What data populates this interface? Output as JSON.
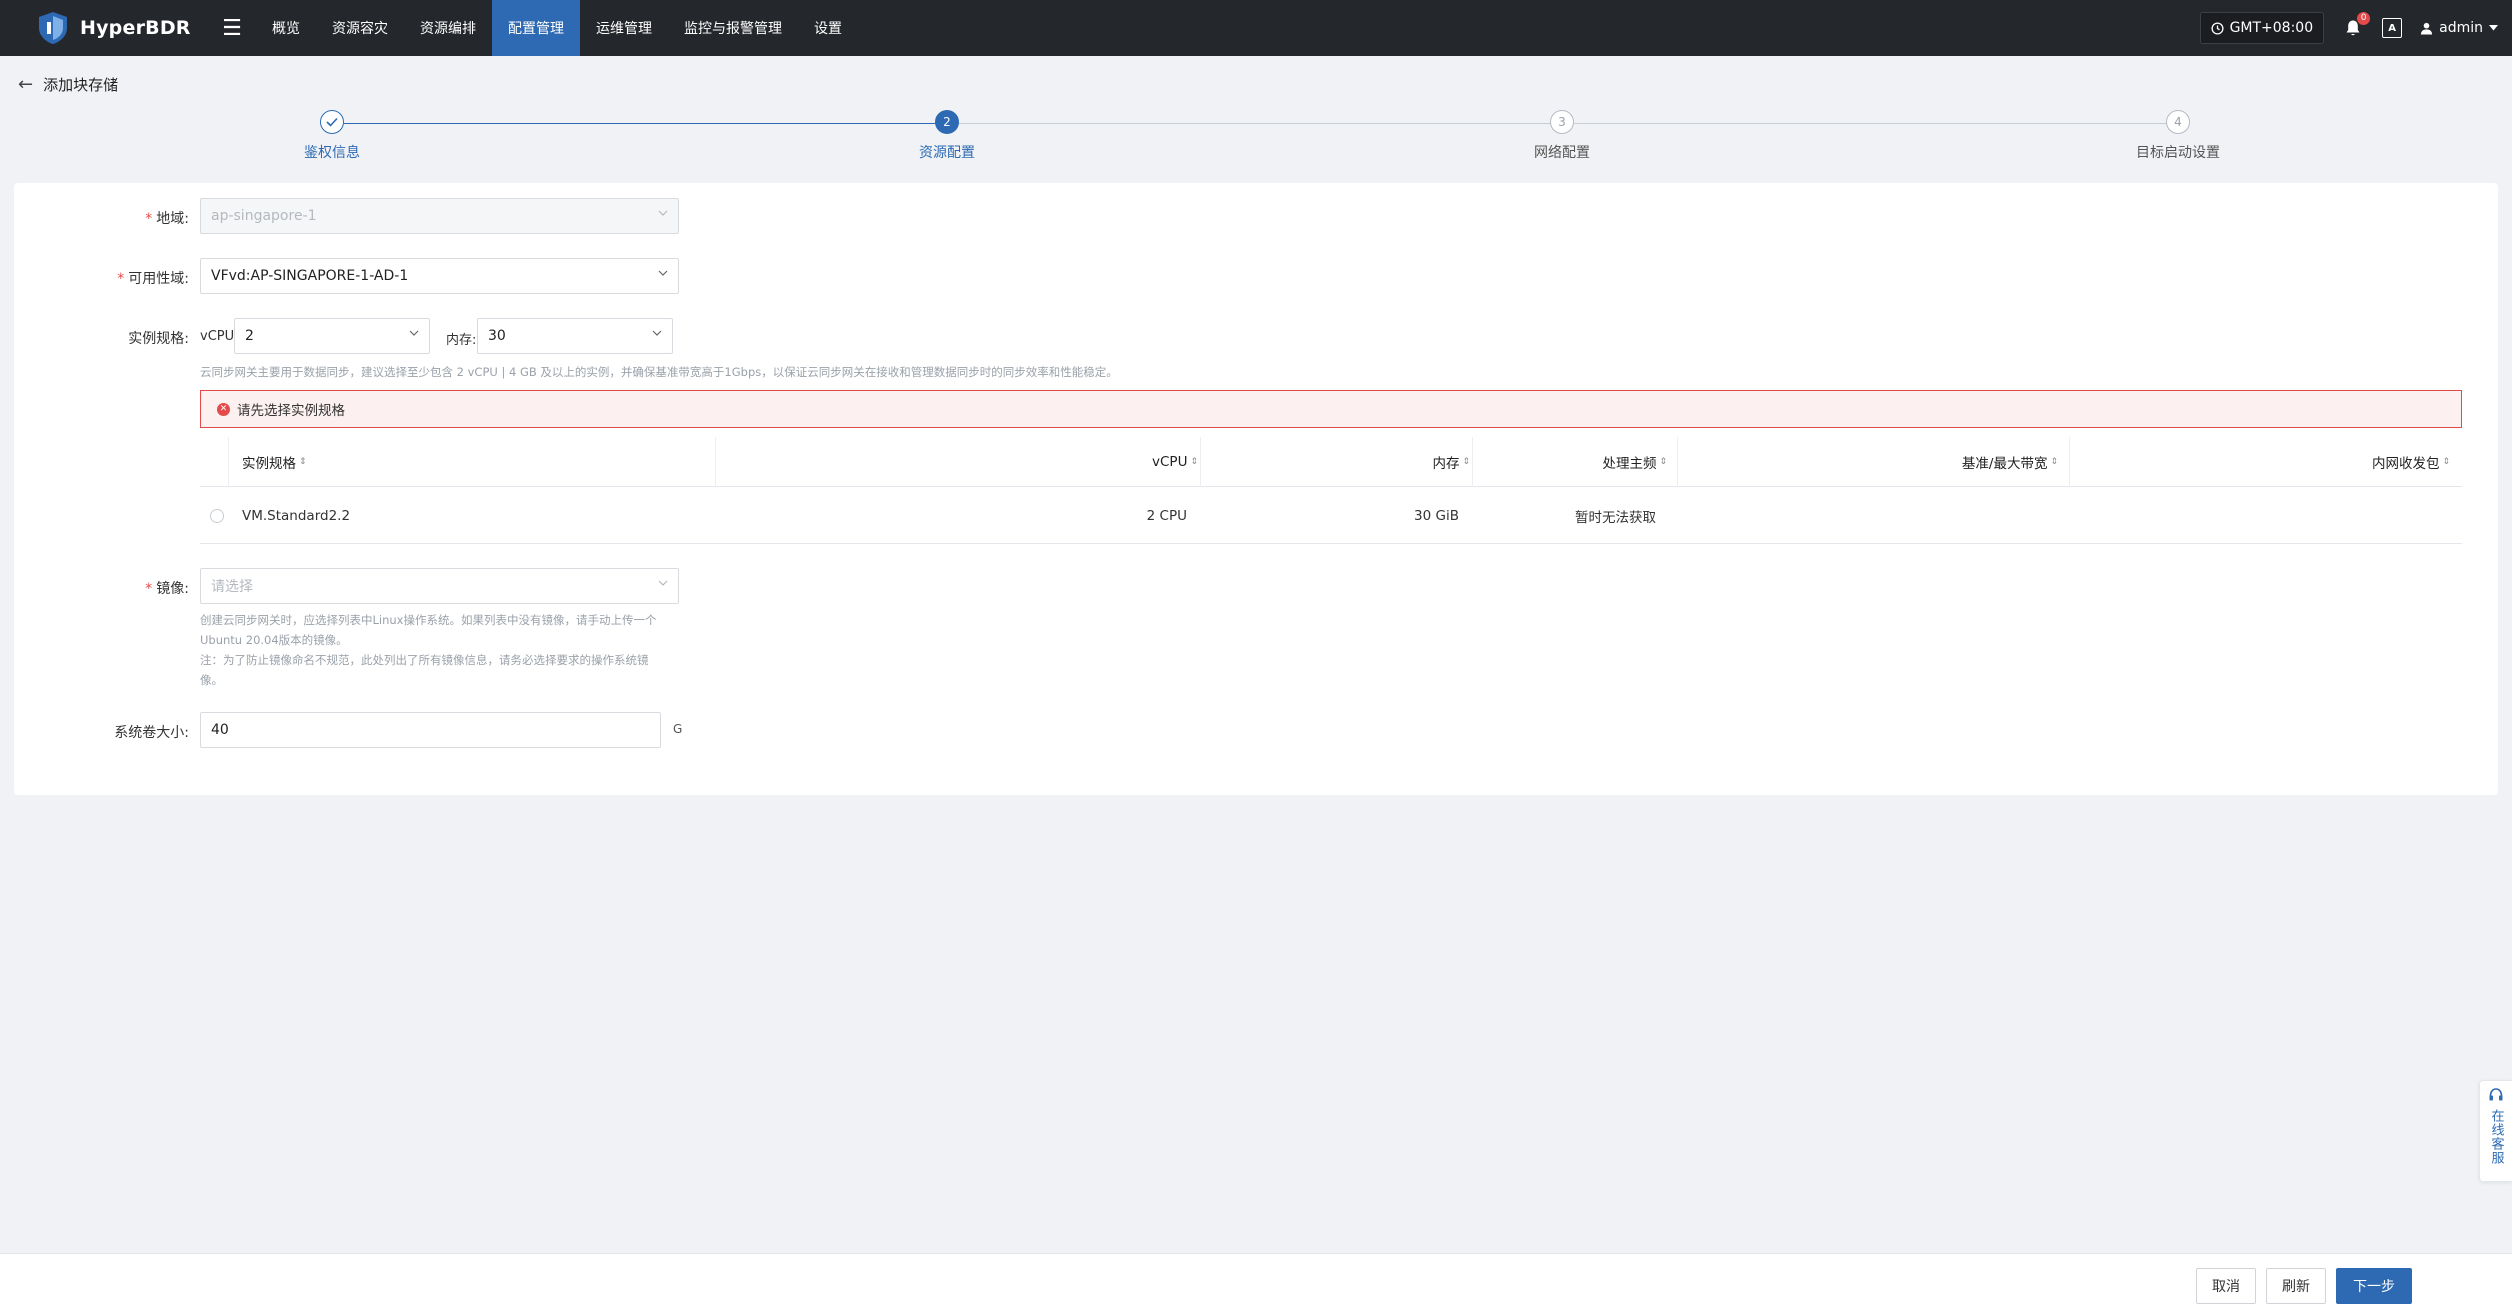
{
  "app": {
    "name": "HyperBDR"
  },
  "nav": {
    "items": [
      {
        "label": "概览",
        "active": false
      },
      {
        "label": "资源容灾",
        "active": false
      },
      {
        "label": "资源编排",
        "active": false
      },
      {
        "label": "配置管理",
        "active": true
      },
      {
        "label": "运维管理",
        "active": false
      },
      {
        "label": "监控与报警管理",
        "active": false
      },
      {
        "label": "设置",
        "active": false
      }
    ]
  },
  "topright": {
    "timezone": "GMT+08:00",
    "bell_badge": "0",
    "lang_icon": "A",
    "user": "admin"
  },
  "page": {
    "title": "添加块存储"
  },
  "steps": [
    {
      "index": "1",
      "label": "鉴权信息",
      "state": "done"
    },
    {
      "index": "2",
      "label": "资源配置",
      "state": "active"
    },
    {
      "index": "3",
      "label": "网络配置",
      "state": "pending"
    },
    {
      "index": "4",
      "label": "目标启动设置",
      "state": "pending"
    }
  ],
  "form": {
    "region": {
      "label": "地域:",
      "value": "ap-singapore-1"
    },
    "availability_domain": {
      "label": "可用性域:",
      "value": "VFvd:AP-SINGAPORE-1-AD-1"
    },
    "instance_spec": {
      "label": "实例规格:",
      "vcpu_label": "vCPU:",
      "vcpu_value": "2",
      "memory_label": "内存:",
      "memory_value": "30",
      "hint": "云同步网关主要用于数据同步，建议选择至少包含 2 vCPU | 4 GB 及以上的实例，并确保基准带宽高于1Gbps，以保证云同步网关在接收和管理数据同步时的同步效率和性能稳定。"
    },
    "alert": {
      "text": "请先选择实例规格"
    },
    "table": {
      "columns": [
        "实例规格",
        "vCPU",
        "内存",
        "处理主频",
        "基准/最大带宽",
        "内网收发包"
      ],
      "rows": [
        {
          "spec": "VM.Standard2.2",
          "vcpu": "2 CPU",
          "memory": "30 GiB",
          "freq": "暂时无法获取",
          "bandwidth": "",
          "pps": ""
        }
      ]
    },
    "image": {
      "label": "镜像:",
      "placeholder": "请选择",
      "hint_line1": "创建云同步网关时，应选择列表中Linux操作系统。如果列表中没有镜像，请手动上传一个",
      "hint_line2": "Ubuntu 20.04版本的镜像。",
      "hint_line3": "注：为了防止镜像命名不规范，此处列出了所有镜像信息，请务必选择要求的操作系统镜",
      "hint_line4": "像。"
    },
    "system_disk": {
      "label": "系统卷大小:",
      "value": "40",
      "unit": "G"
    }
  },
  "footer": {
    "cancel_label": "取消",
    "refresh_label": "刷新",
    "next_label": "下一步"
  },
  "service": {
    "label": "在线客服"
  }
}
